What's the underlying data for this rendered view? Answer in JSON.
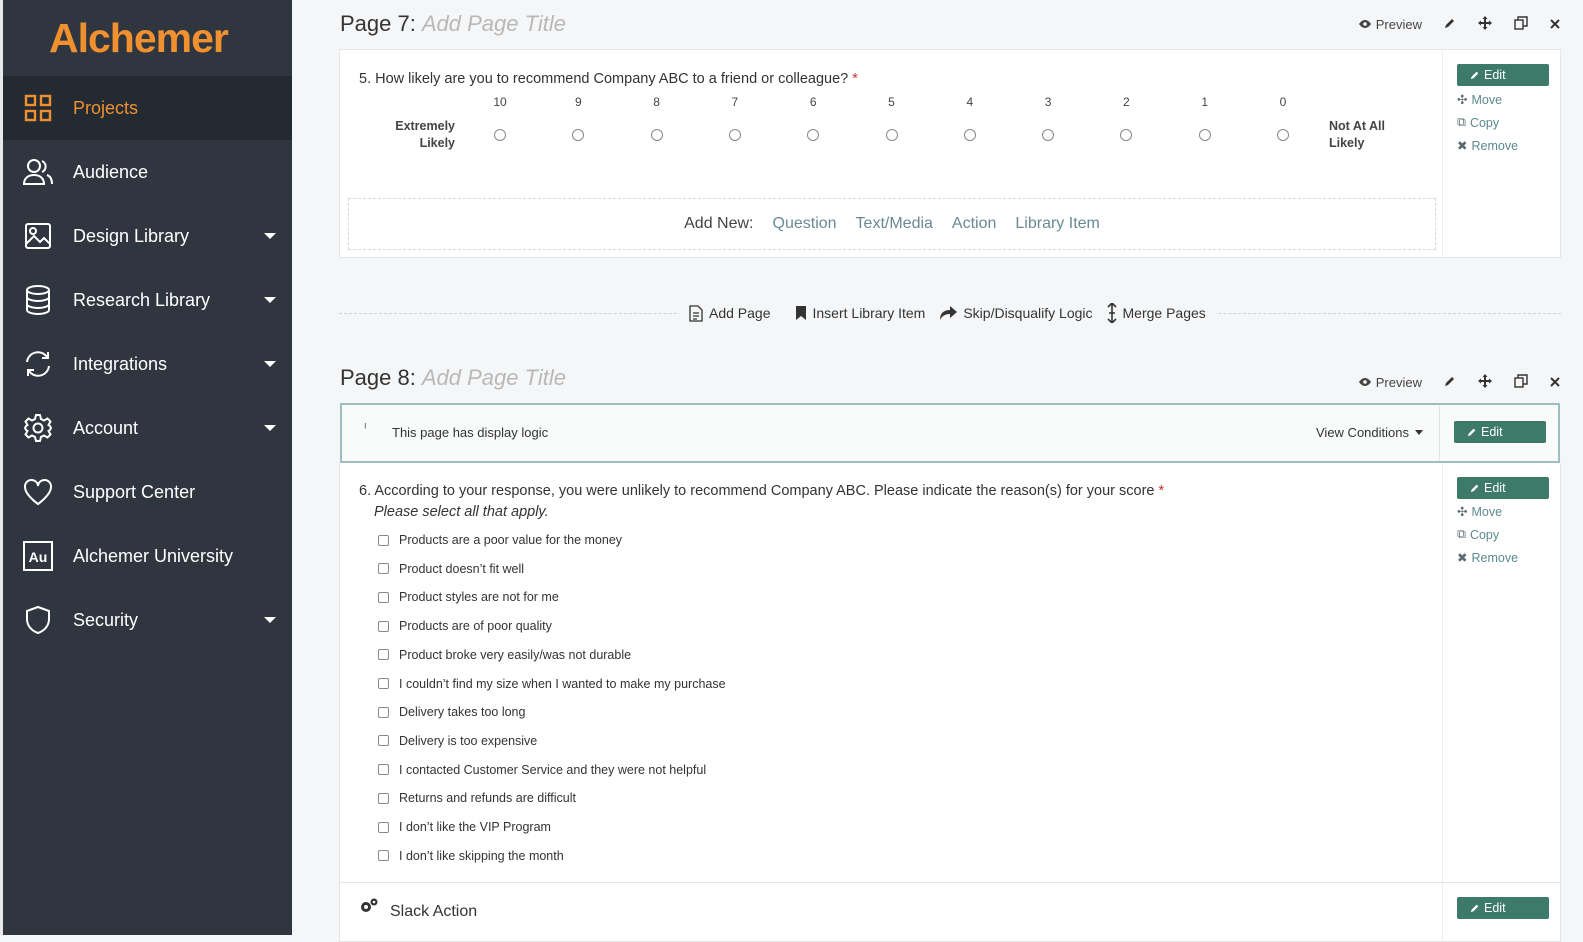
{
  "brand": {
    "name": "Alchemer",
    "color": "#f0902f"
  },
  "sidebar": {
    "items": [
      {
        "label": "Projects",
        "icon": "grid-icon",
        "active": true,
        "has_caret": false
      },
      {
        "label": "Audience",
        "icon": "users-icon",
        "active": false,
        "has_caret": false
      },
      {
        "label": "Design Library",
        "icon": "image-icon",
        "active": false,
        "has_caret": true
      },
      {
        "label": "Research Library",
        "icon": "database-icon",
        "active": false,
        "has_caret": true
      },
      {
        "label": "Integrations",
        "icon": "sync-icon",
        "active": false,
        "has_caret": true
      },
      {
        "label": "Account",
        "icon": "gear-icon",
        "active": false,
        "has_caret": true
      },
      {
        "label": "Support Center",
        "icon": "heart-icon",
        "active": false,
        "has_caret": false
      },
      {
        "label": "Alchemer University",
        "icon": "au-icon",
        "active": false,
        "has_caret": false
      },
      {
        "label": "Security",
        "icon": "shield-icon",
        "active": false,
        "has_caret": true
      }
    ]
  },
  "page_tools": {
    "preview": "Preview"
  },
  "page7": {
    "label": "Page 7:",
    "title_placeholder": "Add Page Title",
    "question": {
      "text": "5. How likely are you to recommend Company ABC to a friend or colleague?",
      "required_mark": "*",
      "scale": [
        "10",
        "9",
        "8",
        "7",
        "6",
        "5",
        "4",
        "3",
        "2",
        "1",
        "0"
      ],
      "left_label_1": "Extremely",
      "left_label_2": "Likely",
      "right_label_1": "Not At All",
      "right_label_2": "Likely"
    },
    "add_new": {
      "label": "Add New:",
      "links": [
        "Question",
        "Text/Media",
        "Action",
        "Library Item"
      ]
    }
  },
  "question_actions": {
    "edit": "Edit",
    "move": "Move",
    "copy": "Copy",
    "remove": "Remove"
  },
  "page_actions": {
    "add_page": "Add Page",
    "insert_library_item": "Insert Library Item",
    "skip_logic": "Skip/Disqualify Logic",
    "merge_pages": "Merge Pages"
  },
  "page8": {
    "label": "Page 8:",
    "title_placeholder": "Add Page Title",
    "logic": {
      "text": "This page has display logic",
      "view_conditions": "View Conditions",
      "edit": "Edit"
    },
    "question": {
      "text": "6. According to your response, you were unlikely to recommend Company ABC. Please indicate the reason(s) for your score",
      "required_mark": "*",
      "instruction": "Please select all that apply.",
      "options": [
        "Products are a poor value for the money",
        "Product doesn’t fit well",
        "Product styles are not for me",
        "Products are of poor quality",
        "Product broke very easily/was not durable",
        "I couldn’t find my size when I wanted to make my purchase",
        "Delivery takes too long",
        "Delivery is too expensive",
        "I contacted Customer Service and they were not helpful",
        "Returns and refunds are difficult",
        "I don’t like the VIP Program",
        "I don’t like skipping the month"
      ]
    },
    "slack_action": {
      "label": "Slack Action",
      "edit": "Edit"
    }
  }
}
